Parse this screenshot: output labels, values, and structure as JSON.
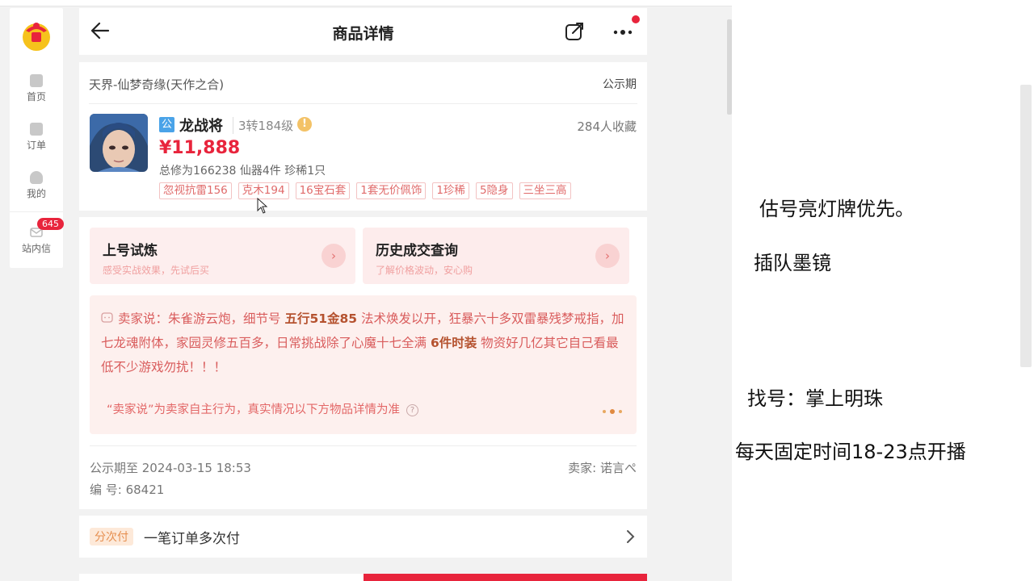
{
  "nav": {
    "items": [
      {
        "label": "首页"
      },
      {
        "label": "订单"
      },
      {
        "label": "我的"
      },
      {
        "label": "站内信",
        "badge": "645"
      }
    ]
  },
  "header": {
    "title": "商品详情"
  },
  "product": {
    "server": "天界-仙梦奇缘(天作之合)",
    "period_label": "公示期",
    "gong": "公",
    "name": "龙战将",
    "level": "3转184级",
    "warn": "!",
    "favorites": "284人收藏",
    "price": "¥11,888",
    "summary": "总修为166238  仙器4件  珍稀1只",
    "tags": [
      "忽视抗雷156",
      "克木194",
      "16宝石套",
      "1套无价佩饰",
      "1珍稀",
      "5隐身",
      "三坐三高"
    ]
  },
  "entries": [
    {
      "title": "上号试炼",
      "subtitle": "感受实战效果，先试后买",
      "arrow": "›"
    },
    {
      "title": "历史成交查询",
      "subtitle": "了解价格波动，安心购",
      "arrow": "›"
    }
  ],
  "seller_says": {
    "prefix": "卖家说：朱雀游云炮，细节号 ",
    "bold1": "五行51金85",
    "middle": " 法术焕发以开，狂暴六十多双雷暴残梦戒指，加七龙魂附体，家园灵修五百多，日常挑战除了心魔十七全满 ",
    "bold2": "6件时装",
    "suffix": " 物资好几亿其它自己看最低不少游戏勿扰！！！",
    "note": "“卖家说”为卖家自主行为，真实情况以下方物品详情为准",
    "help": "?"
  },
  "meta": {
    "pub_time": "公示期至 2024-03-15 18:53",
    "serial": "编 号: 68421",
    "seller": "卖家: 诺言ぺ"
  },
  "payment": {
    "tag": "分次付",
    "text": "一笔订单多次付"
  },
  "right_notes": [
    {
      "text": "估号亮灯牌优先。"
    },
    {
      "text": "插队墨镜"
    },
    {
      "text": "找号：掌上明珠"
    },
    {
      "text": "每天固定时间18-23点开播"
    }
  ],
  "colors": {
    "accent": "#e8243c",
    "seller_text": "#d95c5c",
    "tag_text": "#e06a6a"
  }
}
